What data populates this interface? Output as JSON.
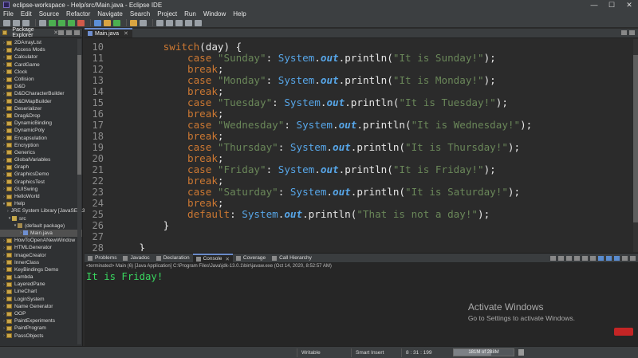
{
  "window": {
    "title": "eclipse-workspace - Help/src/Main.java - Eclipse IDE",
    "controls": [
      "—",
      "☐",
      "✕"
    ]
  },
  "menu": [
    "File",
    "Edit",
    "Source",
    "Refactor",
    "Navigate",
    "Search",
    "Project",
    "Run",
    "Window",
    "Help"
  ],
  "package_explorer": {
    "title": "Package Explorer",
    "projects_before": [
      "2DArrayList",
      "Access Mods",
      "Calculator",
      "CardGame",
      "Clock",
      "Collision",
      "D&D",
      "D&DCharacterBuilder",
      "D&DMapBuilder",
      "Deserializer",
      "Drag&Drop",
      "DynamicBinding",
      "DynamicPoly",
      "Encapsulation",
      "Encryption",
      "Generics",
      "GlobalVariables",
      "Graph",
      "GraphicsDemo",
      "GraphicsTest",
      "GUISwing",
      "HelloWorld"
    ],
    "open_project": "Help",
    "jre_library": "JRE System Library [JavaSE-13]",
    "src_folder": "src",
    "default_package": "(default package)",
    "selected_file": "Main.java",
    "projects_after": [
      "HowToOpenANewWindow",
      "HTMLGenerator",
      "ImageCreator",
      "InnerClass",
      "KeyBindings Demo",
      "Lambda",
      "LayeredPane",
      "LineChart",
      "LoginSystem",
      "Name Generator",
      "OOP",
      "PaintExperiments",
      "PaintProgram",
      "PassObjects"
    ]
  },
  "editor": {
    "tab": "Main.java",
    "lines": [
      {
        "no": "10",
        "indent": 8,
        "tokens": [
          {
            "t": "switch",
            "c": "kw"
          },
          {
            "t": "(day) {",
            "c": "plain"
          }
        ]
      },
      {
        "no": "11",
        "indent": 12,
        "tokens": [
          {
            "t": "case ",
            "c": "kw"
          },
          {
            "t": "\"Sunday\"",
            "c": "str"
          },
          {
            "t": ": ",
            "c": "plain"
          },
          {
            "t": "System",
            "c": "cls"
          },
          {
            "t": ".",
            "c": "plain"
          },
          {
            "t": "out",
            "c": "fld"
          },
          {
            "t": ".println(",
            "c": "plain"
          },
          {
            "t": "\"It is Sunday!\"",
            "c": "str"
          },
          {
            "t": ");",
            "c": "plain"
          }
        ]
      },
      {
        "no": "12",
        "indent": 12,
        "tokens": [
          {
            "t": "break",
            "c": "kw"
          },
          {
            "t": ";",
            "c": "plain"
          }
        ]
      },
      {
        "no": "13",
        "indent": 12,
        "tokens": [
          {
            "t": "case ",
            "c": "kw"
          },
          {
            "t": "\"Monday\"",
            "c": "str"
          },
          {
            "t": ": ",
            "c": "plain"
          },
          {
            "t": "System",
            "c": "cls"
          },
          {
            "t": ".",
            "c": "plain"
          },
          {
            "t": "out",
            "c": "fld"
          },
          {
            "t": ".println(",
            "c": "plain"
          },
          {
            "t": "\"It is Monday!\"",
            "c": "str"
          },
          {
            "t": ");",
            "c": "plain"
          }
        ]
      },
      {
        "no": "14",
        "indent": 12,
        "tokens": [
          {
            "t": "break",
            "c": "kw"
          },
          {
            "t": ";",
            "c": "plain"
          }
        ]
      },
      {
        "no": "15",
        "indent": 12,
        "tokens": [
          {
            "t": "case ",
            "c": "kw"
          },
          {
            "t": "\"Tuesday\"",
            "c": "str"
          },
          {
            "t": ": ",
            "c": "plain"
          },
          {
            "t": "System",
            "c": "cls"
          },
          {
            "t": ".",
            "c": "plain"
          },
          {
            "t": "out",
            "c": "fld"
          },
          {
            "t": ".println(",
            "c": "plain"
          },
          {
            "t": "\"It is Tuesday!\"",
            "c": "str"
          },
          {
            "t": ");",
            "c": "plain"
          }
        ]
      },
      {
        "no": "16",
        "indent": 12,
        "tokens": [
          {
            "t": "break",
            "c": "kw"
          },
          {
            "t": ";",
            "c": "plain"
          }
        ]
      },
      {
        "no": "17",
        "indent": 12,
        "tokens": [
          {
            "t": "case ",
            "c": "kw"
          },
          {
            "t": "\"Wednesday\"",
            "c": "str"
          },
          {
            "t": ": ",
            "c": "plain"
          },
          {
            "t": "System",
            "c": "cls"
          },
          {
            "t": ".",
            "c": "plain"
          },
          {
            "t": "out",
            "c": "fld"
          },
          {
            "t": ".println(",
            "c": "plain"
          },
          {
            "t": "\"It is Wednesday!\"",
            "c": "str"
          },
          {
            "t": ");",
            "c": "plain"
          }
        ]
      },
      {
        "no": "18",
        "indent": 12,
        "tokens": [
          {
            "t": "break",
            "c": "kw"
          },
          {
            "t": ";",
            "c": "plain"
          }
        ]
      },
      {
        "no": "19",
        "indent": 12,
        "tokens": [
          {
            "t": "case ",
            "c": "kw"
          },
          {
            "t": "\"Thursday\"",
            "c": "str"
          },
          {
            "t": ": ",
            "c": "plain"
          },
          {
            "t": "System",
            "c": "cls"
          },
          {
            "t": ".",
            "c": "plain"
          },
          {
            "t": "out",
            "c": "fld"
          },
          {
            "t": ".println(",
            "c": "plain"
          },
          {
            "t": "\"It is Thursday!\"",
            "c": "str"
          },
          {
            "t": ");",
            "c": "plain"
          }
        ]
      },
      {
        "no": "20",
        "indent": 12,
        "tokens": [
          {
            "t": "break",
            "c": "kw"
          },
          {
            "t": ";",
            "c": "plain"
          }
        ]
      },
      {
        "no": "21",
        "indent": 12,
        "tokens": [
          {
            "t": "case ",
            "c": "kw"
          },
          {
            "t": "\"Friday\"",
            "c": "str"
          },
          {
            "t": ": ",
            "c": "plain"
          },
          {
            "t": "System",
            "c": "cls"
          },
          {
            "t": ".",
            "c": "plain"
          },
          {
            "t": "out",
            "c": "fld"
          },
          {
            "t": ".println(",
            "c": "plain"
          },
          {
            "t": "\"It is Friday!\"",
            "c": "str"
          },
          {
            "t": ");",
            "c": "plain"
          }
        ]
      },
      {
        "no": "22",
        "indent": 12,
        "tokens": [
          {
            "t": "break",
            "c": "kw"
          },
          {
            "t": ";",
            "c": "plain"
          }
        ]
      },
      {
        "no": "23",
        "indent": 12,
        "tokens": [
          {
            "t": "case ",
            "c": "kw"
          },
          {
            "t": "\"Saturday\"",
            "c": "str"
          },
          {
            "t": ": ",
            "c": "plain"
          },
          {
            "t": "System",
            "c": "cls"
          },
          {
            "t": ".",
            "c": "plain"
          },
          {
            "t": "out",
            "c": "fld"
          },
          {
            "t": ".println(",
            "c": "plain"
          },
          {
            "t": "\"It is Saturday!\"",
            "c": "str"
          },
          {
            "t": ");",
            "c": "plain"
          }
        ]
      },
      {
        "no": "24",
        "indent": 12,
        "tokens": [
          {
            "t": "break",
            "c": "kw"
          },
          {
            "t": ";",
            "c": "plain"
          }
        ]
      },
      {
        "no": "25",
        "indent": 12,
        "tokens": [
          {
            "t": "default",
            "c": "kw"
          },
          {
            "t": ": ",
            "c": "plain"
          },
          {
            "t": "System",
            "c": "cls"
          },
          {
            "t": ".",
            "c": "plain"
          },
          {
            "t": "out",
            "c": "fld"
          },
          {
            "t": ".println(",
            "c": "plain"
          },
          {
            "t": "\"That is not a day!\"",
            "c": "str"
          },
          {
            "t": ");",
            "c": "plain"
          }
        ]
      },
      {
        "no": "26",
        "indent": 8,
        "tokens": [
          {
            "t": "}",
            "c": "plain"
          }
        ]
      },
      {
        "no": "27",
        "indent": 0,
        "tokens": []
      },
      {
        "no": "28",
        "indent": 4,
        "tokens": [
          {
            "t": "}",
            "c": "plain"
          }
        ]
      }
    ]
  },
  "console": {
    "tabs": [
      "Problems",
      "Javadoc",
      "Declaration",
      "Console",
      "Coverage",
      "Call Hierarchy"
    ],
    "active_tab": "Console",
    "status": "<terminated> Main (6) [Java Application] C:\\Program Files\\Java\\jdk-13.0.1\\bin\\javaw.exe (Oct 14, 2020, 8:52:57 AM)",
    "output": "It is Friday!"
  },
  "watermark": {
    "line1": "Activate Windows",
    "line2": "Go to Settings to activate Windows."
  },
  "statusbar": {
    "writable": "Writable",
    "insert_mode": "Smart Insert",
    "position": "8 : 31 : 199",
    "heap": "181M of 288M",
    "heap_fraction": 0.63
  },
  "colors": {
    "keyword": "#cc7832",
    "string": "#6a8759",
    "class": "#57a6e8",
    "console_output": "#39d65f"
  }
}
